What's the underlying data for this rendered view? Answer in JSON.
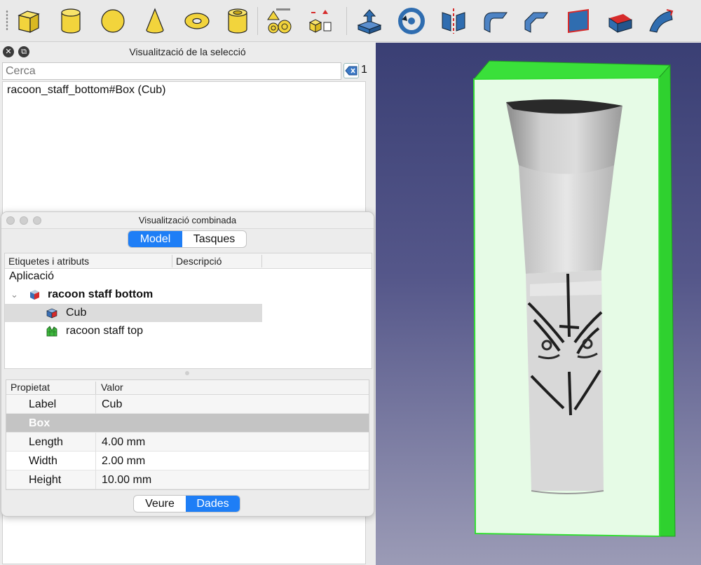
{
  "toolbar": {
    "icons": [
      "cube-icon",
      "cylinder-icon",
      "sphere-icon",
      "cone-icon",
      "torus-icon",
      "tube-icon",
      "primitives-icon",
      "shape-builder-icon",
      "extrude-icon",
      "revolve-icon",
      "mirror-icon",
      "fillet-icon",
      "chamfer-icon",
      "make-face-icon",
      "ruled-surface-icon",
      "loft-icon"
    ],
    "colors": {
      "yellow": "#f2d43c",
      "blue": "#2f6db0",
      "red": "#d62b2b"
    }
  },
  "selection": {
    "title": "Visualització de la selecció",
    "search_placeholder": "Cerca",
    "count": "1",
    "item": "racoon_staff_bottom#Box (Cub)"
  },
  "combo": {
    "title": "Visualització combinada",
    "tabs": [
      {
        "label": "Model",
        "active": true
      },
      {
        "label": "Tasques",
        "active": false
      }
    ],
    "tree": {
      "col_labels": "Etiquetes i atributs",
      "col_desc": "Descripció",
      "root": "Aplicació",
      "doc": "racoon staff bottom",
      "items": [
        "Cub",
        "racoon staff top"
      ]
    },
    "properties": {
      "col_prop": "Propietat",
      "col_value": "Valor",
      "label_name": "Label",
      "label_value": "Cub",
      "group": "Box",
      "rows": [
        {
          "name": "Length",
          "value": "4.00 mm"
        },
        {
          "name": "Width",
          "value": "2.00 mm"
        },
        {
          "name": "Height",
          "value": "10.00 mm"
        }
      ]
    },
    "bottom_tabs": [
      {
        "label": "Veure",
        "active": false
      },
      {
        "label": "Dades",
        "active": true
      }
    ]
  },
  "viewport": {
    "colors": {
      "box_green": "#33dd33",
      "box_face": "#e6fbe6",
      "bg_top": "#3a3f74",
      "bg_bottom": "#9b9bb6"
    }
  }
}
